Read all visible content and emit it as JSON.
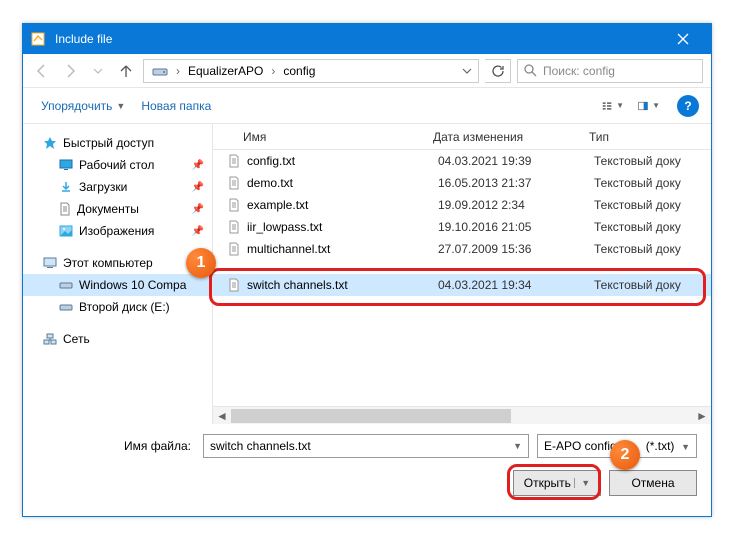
{
  "window": {
    "title": "Include file"
  },
  "addressbar": {
    "segments": [
      "EqualizerAPO",
      "config"
    ]
  },
  "search": {
    "placeholder": "Поиск: config"
  },
  "toolbar": {
    "organize": "Упорядочить",
    "newfolder": "Новая папка"
  },
  "sidebar": {
    "quick": "Быстрый доступ",
    "desktop": "Рабочий стол",
    "downloads": "Загрузки",
    "documents": "Документы",
    "pictures": "Изображения",
    "thispc": "Этот компьютер",
    "win10": "Windows 10 Compa",
    "disk2": "Второй диск (E:)",
    "network": "Сеть"
  },
  "columns": {
    "name": "Имя",
    "date": "Дата изменения",
    "type": "Тип"
  },
  "files": [
    {
      "name": "config.txt",
      "date": "04.03.2021 19:39",
      "type": "Текстовый доку"
    },
    {
      "name": "demo.txt",
      "date": "16.05.2013 21:37",
      "type": "Текстовый доку"
    },
    {
      "name": "example.txt",
      "date": "19.09.2012 2:34",
      "type": "Текстовый доку"
    },
    {
      "name": "iir_lowpass.txt",
      "date": "19.10.2016 21:05",
      "type": "Текстовый доку"
    },
    {
      "name": "multichannel.txt",
      "date": "27.07.2009 15:36",
      "type": "Текстовый доку"
    },
    {
      "name": "",
      "date": "",
      "type": ""
    },
    {
      "name": "switch channels.txt",
      "date": "04.03.2021 19:34",
      "type": "Текстовый доку"
    }
  ],
  "footer": {
    "filename_label": "Имя файла:",
    "filename_value": "switch channels.txt",
    "filter": "E-APO config",
    "filter_ext": "(*.txt)",
    "open": "Открыть",
    "cancel": "Отмена"
  },
  "badges": {
    "one": "1",
    "two": "2"
  }
}
